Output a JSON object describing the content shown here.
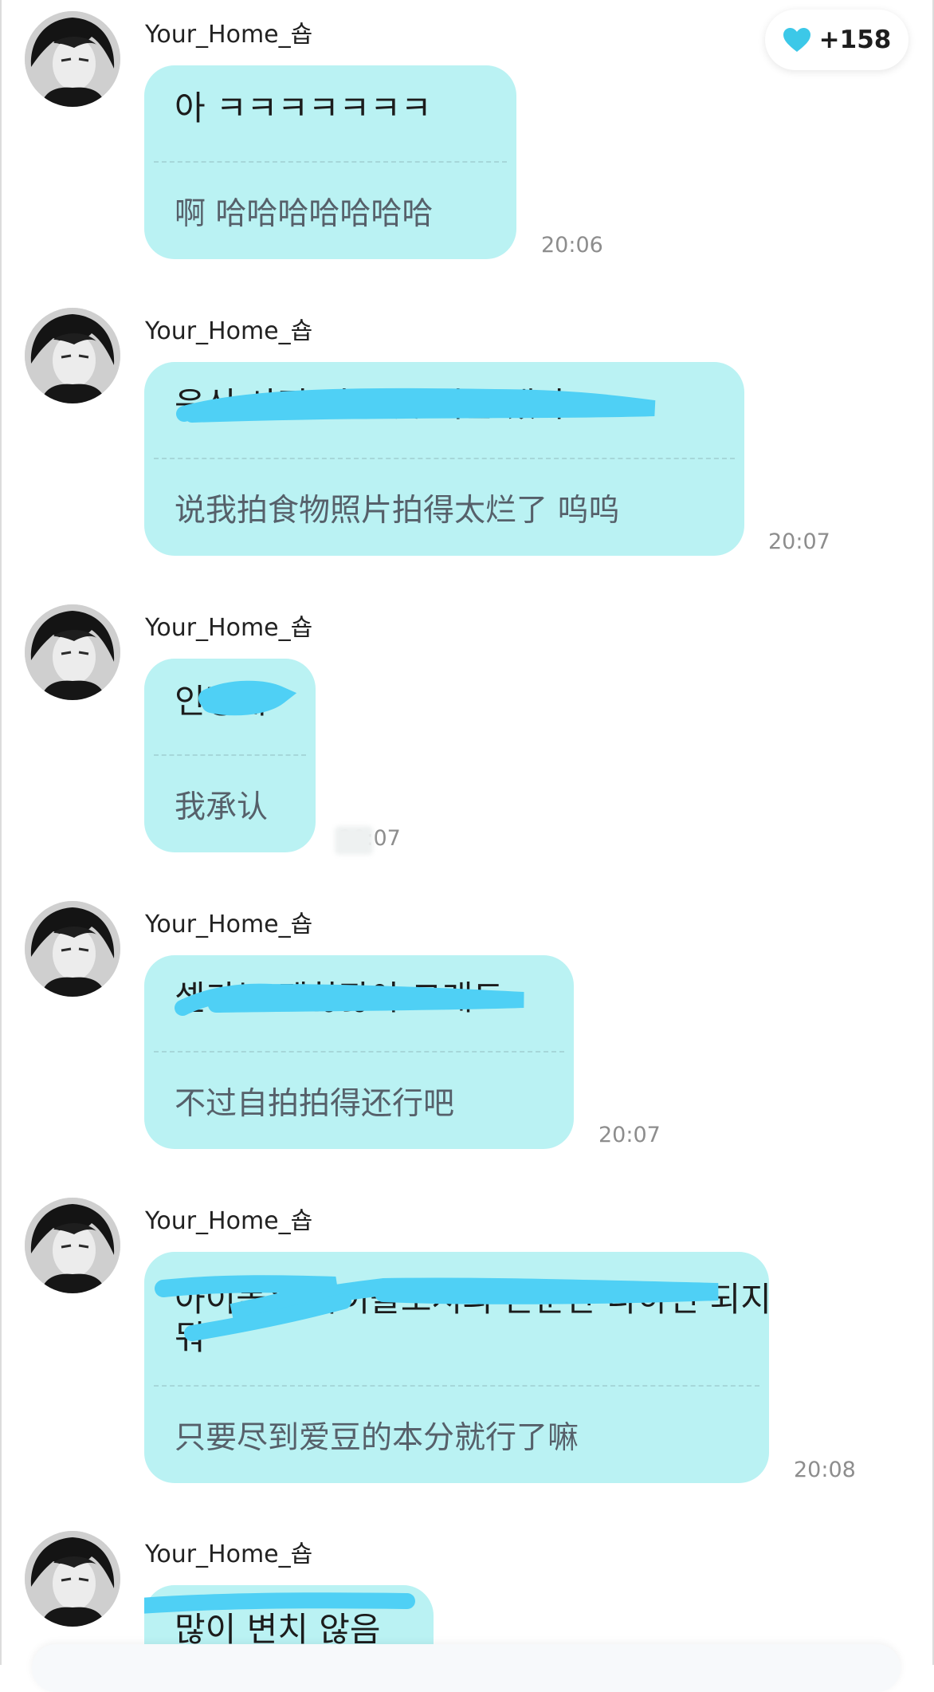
{
  "badge": {
    "icon": "heart-icon",
    "count": "+158",
    "color": "#3cc8e8"
  },
  "colors": {
    "bubble": "#baf2f3",
    "scribble": "#4fd0f5"
  },
  "messages": [
    {
      "sender": "Your_Home_숍",
      "korean": "아 ㅋㅋㅋㅋㅋㅋㅋ",
      "chinese": "啊 哈哈哈哈哈哈哈",
      "time": "20:06"
    },
    {
      "sender": "Your_Home_숍",
      "korean": "음식 사진 너무 못 찍는 댔냐 ㅜㅜ",
      "chinese": "说我拍食物照片拍得太烂了 呜呜",
      "time": "20:07"
    },
    {
      "sender": "Your_Home_숍",
      "korean": "인정해",
      "chinese": "我承认",
      "time": "20:07"
    },
    {
      "sender": "Your_Home_숍",
      "korean": "셀카는 괜찮잖아 그래도",
      "chinese": "不过自拍拍得还行吧",
      "time": "20:07"
    },
    {
      "sender": "Your_Home_숍",
      "korean_lines": [
        "아이돌은 아이돌로서의 본분만 다하면 되지",
        "뭐"
      ],
      "chinese": "只要尽到爱豆的本分就行了嘛",
      "time": "20:08"
    },
    {
      "sender": "Your_Home_숍",
      "korean": "많이 변치 않음"
    }
  ]
}
